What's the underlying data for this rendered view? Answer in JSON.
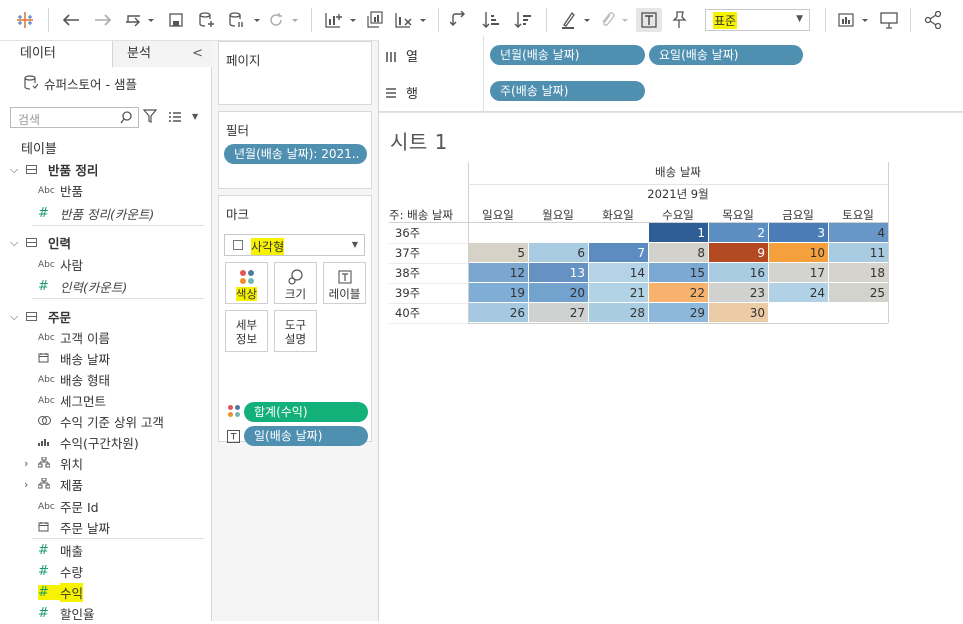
{
  "data_pane": {
    "tab_data": "데이터",
    "tab_analysis": "분석",
    "datasource": "슈퍼스토어 - 샘플",
    "search_placeholder": "검색",
    "tables_header": "테이블",
    "groups": [
      {
        "name": "반품 정리",
        "fields": [
          {
            "name": "반품",
            "type": "abc"
          },
          {
            "name": "반품 정리(카운트)",
            "type": "measure"
          }
        ]
      },
      {
        "name": "인력",
        "fields": [
          {
            "name": "사람",
            "type": "abc"
          },
          {
            "name": "인력(카운트)",
            "type": "measure"
          }
        ]
      },
      {
        "name": "주문",
        "fields": [
          {
            "name": "고객 이름",
            "type": "abc"
          },
          {
            "name": "배송 날짜",
            "type": "date"
          },
          {
            "name": "배송 형태",
            "type": "abc"
          },
          {
            "name": "세그먼트",
            "type": "abc"
          },
          {
            "name": "수익 기준 상위 고객",
            "type": "set"
          },
          {
            "name": "수익(구간차원)",
            "type": "bin"
          },
          {
            "name": "위치",
            "type": "hier"
          },
          {
            "name": "제품",
            "type": "hier"
          },
          {
            "name": "주문 Id",
            "type": "abc"
          },
          {
            "name": "주문 날짜",
            "type": "date"
          },
          {
            "name": "매출",
            "type": "measure"
          },
          {
            "name": "수량",
            "type": "measure"
          },
          {
            "name": "수익",
            "type": "measure"
          },
          {
            "name": "할인율",
            "type": "measure"
          }
        ]
      }
    ]
  },
  "toolbar": {
    "format_select": "표준"
  },
  "cards": {
    "pages_title": "페이지",
    "filters_title": "필터",
    "filter_pill": "년월(배송 날짜): 2021..",
    "marks_title": "마크",
    "mark_type": "사각형",
    "buttons": {
      "color": "색상",
      "size": "크기",
      "label": "레이블",
      "detail": "세부\n정보",
      "tooltip": "도구\n설명"
    },
    "mark_pills": [
      "합계(수익)",
      "일(배송 날짜)"
    ]
  },
  "shelves": {
    "columns_label": "열",
    "rows_label": "행",
    "columns_pills": [
      "년월(배송 날짜)",
      "요일(배송 날짜)"
    ],
    "rows_pills": [
      "주(배송 날짜)"
    ]
  },
  "viz": {
    "sheet_title": "시트 1",
    "header_top": "배송 날짜",
    "header_month": "2021년 9월",
    "row_header_label": "주: 배송 날짜",
    "weekdays": [
      "일요일",
      "월요일",
      "화요일",
      "수요일",
      "목요일",
      "금요일",
      "토요일"
    ],
    "weeks": [
      "36주",
      "37주",
      "38주",
      "39주",
      "40주"
    ]
  },
  "chart_data": {
    "type": "heatmap",
    "title": "시트 1",
    "x": [
      "일요일",
      "월요일",
      "화요일",
      "수요일",
      "목요일",
      "금요일",
      "토요일"
    ],
    "y": [
      "36주",
      "37주",
      "38주",
      "39주",
      "40주"
    ],
    "cells": [
      {
        "week": "36주",
        "day": 3,
        "label": 1,
        "color": "#2f5d95"
      },
      {
        "week": "36주",
        "day": 4,
        "label": 2,
        "color": "#5c8ec2"
      },
      {
        "week": "36주",
        "day": 5,
        "label": 3,
        "color": "#4a7db8"
      },
      {
        "week": "36주",
        "day": 6,
        "label": 4,
        "color": "#6896c6"
      },
      {
        "week": "37주",
        "day": 0,
        "label": 5,
        "color": "#d7d2c8"
      },
      {
        "week": "37주",
        "day": 1,
        "label": 6,
        "color": "#a8cbe2"
      },
      {
        "week": "37주",
        "day": 2,
        "label": 7,
        "color": "#5c8cc0"
      },
      {
        "week": "37주",
        "day": 3,
        "label": 8,
        "color": "#d2d1cb"
      },
      {
        "week": "37주",
        "day": 4,
        "label": 9,
        "color": "#b44a22"
      },
      {
        "week": "37주",
        "day": 5,
        "label": 10,
        "color": "#f5a03c"
      },
      {
        "week": "37주",
        "day": 6,
        "label": 11,
        "color": "#a8cbe2"
      },
      {
        "week": "38주",
        "day": 0,
        "label": 12,
        "color": "#7aa6d0"
      },
      {
        "week": "38주",
        "day": 1,
        "label": 13,
        "color": "#6691c3"
      },
      {
        "week": "38주",
        "day": 2,
        "label": 14,
        "color": "#b4d3e6"
      },
      {
        "week": "38주",
        "day": 3,
        "label": 15,
        "color": "#7ca9d3"
      },
      {
        "week": "38주",
        "day": 4,
        "label": 16,
        "color": "#a9cce3"
      },
      {
        "week": "38주",
        "day": 5,
        "label": 17,
        "color": "#d3d4cf"
      },
      {
        "week": "38주",
        "day": 6,
        "label": 18,
        "color": "#d5d3cc"
      },
      {
        "week": "39주",
        "day": 0,
        "label": 19,
        "color": "#80add5"
      },
      {
        "week": "39주",
        "day": 1,
        "label": 20,
        "color": "#74a2cf"
      },
      {
        "week": "39주",
        "day": 2,
        "label": 21,
        "color": "#b2d2e6"
      },
      {
        "week": "39주",
        "day": 3,
        "label": 22,
        "color": "#f7b36e"
      },
      {
        "week": "39주",
        "day": 4,
        "label": 23,
        "color": "#d1d2cf"
      },
      {
        "week": "39주",
        "day": 5,
        "label": 24,
        "color": "#b1d1e6"
      },
      {
        "week": "39주",
        "day": 6,
        "label": 25,
        "color": "#d2d3cd"
      },
      {
        "week": "40주",
        "day": 0,
        "label": 26,
        "color": "#a6c9e2"
      },
      {
        "week": "40주",
        "day": 1,
        "label": 27,
        "color": "#cfd2d0"
      },
      {
        "week": "40주",
        "day": 2,
        "label": 28,
        "color": "#a9cce3"
      },
      {
        "week": "40주",
        "day": 3,
        "label": 29,
        "color": "#8db8dc"
      },
      {
        "week": "40주",
        "day": 4,
        "label": 30,
        "color": "#ebcca6"
      }
    ]
  }
}
